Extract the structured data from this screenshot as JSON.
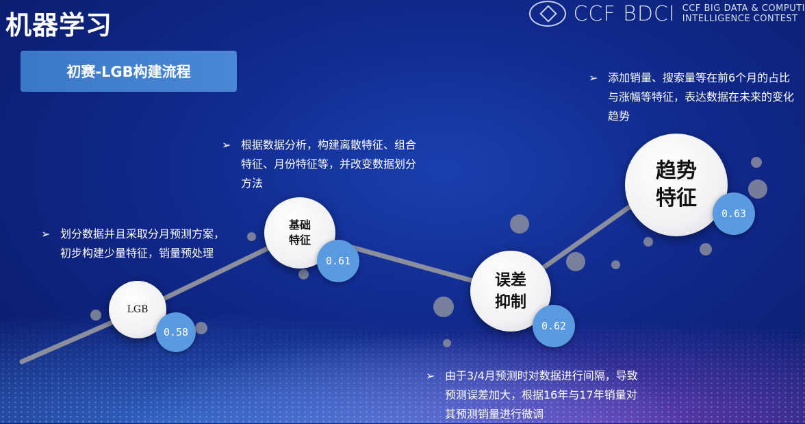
{
  "header": {
    "title": "机器学习",
    "subtitle": "初赛-LGB构建流程",
    "brand": "CCF BDCI",
    "contest_line1": "CCF BIG DATA & COMPUTI",
    "contest_line2": "INTELLIGENCE CONTEST"
  },
  "steps": [
    {
      "label": "LGB",
      "score": "0.58",
      "description": "划分数据并且采取分月预测方案，初步构建少量特征，销量预处理"
    },
    {
      "label_line1": "基础",
      "label_line2": "特征",
      "score": "0.61",
      "description": "根据数据分析，构建离散特征、组合特征、月份特征等，并改变数据划分方法"
    },
    {
      "label_line1": "误差",
      "label_line2": "抑制",
      "score": "0.62",
      "description": "由于3/4月预测时对数据进行间隔，导致预测误差加大，根据16年与17年销量对其预测销量进行微调"
    },
    {
      "label_line1": "趋势",
      "label_line2": "特征",
      "score": "0.63",
      "description": "添加销量、搜索量等在前6个月的占比与涨幅等特征，表达数据在未来的变化趋势"
    }
  ],
  "bullet_symbol": "➢",
  "colors": {
    "accent": "#5a9ae0",
    "background": "#10288a",
    "subtitle_box": "#3a78c8",
    "line": "#8b8e9c"
  }
}
